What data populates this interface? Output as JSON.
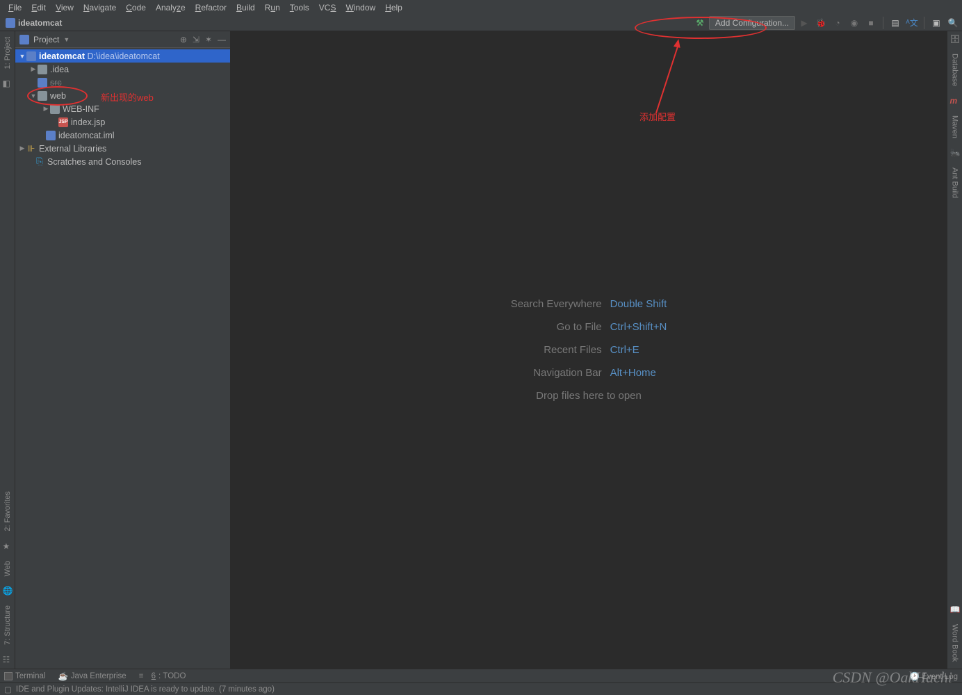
{
  "menu": [
    "File",
    "Edit",
    "View",
    "Navigate",
    "Code",
    "Analyze",
    "Refactor",
    "Build",
    "Run",
    "Tools",
    "VCS",
    "Window",
    "Help"
  ],
  "breadcrumb": {
    "project": "ideatomcat"
  },
  "toolbar": {
    "add_conf": "Add Configuration..."
  },
  "sidebar": {
    "title": "Project",
    "root": {
      "name": "ideatomcat",
      "path": "D:\\idea\\ideatomcat"
    },
    "idea_folder": ".idea",
    "src_folder": "src",
    "web_folder": "web",
    "webinf": "WEB-INF",
    "indexjsp": "index.jsp",
    "iml": "ideatomcat.iml",
    "ext": "External Libraries",
    "scratch": "Scratches and Consoles"
  },
  "right_tools": [
    "Database",
    "Maven",
    "Ant Build",
    "Word Book"
  ],
  "left_tools": {
    "project": "1: Project",
    "fav": "2: Favorites",
    "web": "Web",
    "struct": "7: Structure"
  },
  "editor_hints": {
    "search": {
      "lbl": "Search Everywhere",
      "key": "Double Shift"
    },
    "gotofile": {
      "lbl": "Go to File",
      "key": "Ctrl+Shift+N"
    },
    "recent": {
      "lbl": "Recent Files",
      "key": "Ctrl+E"
    },
    "navbar": {
      "lbl": "Navigation Bar",
      "key": "Alt+Home"
    },
    "drop": "Drop files here to open"
  },
  "bottom": {
    "terminal": "Terminal",
    "java": "Java Enterprise",
    "todo": "6: TODO",
    "eventlog": "Event Log"
  },
  "status": "IDE and Plugin Updates: IntelliJ IDEA is ready to update. (7 minutes ago)",
  "annotations": {
    "web_new": "新出现的web",
    "add_conf": "添加配置"
  },
  "watermark": "CSDN @OakHachi"
}
